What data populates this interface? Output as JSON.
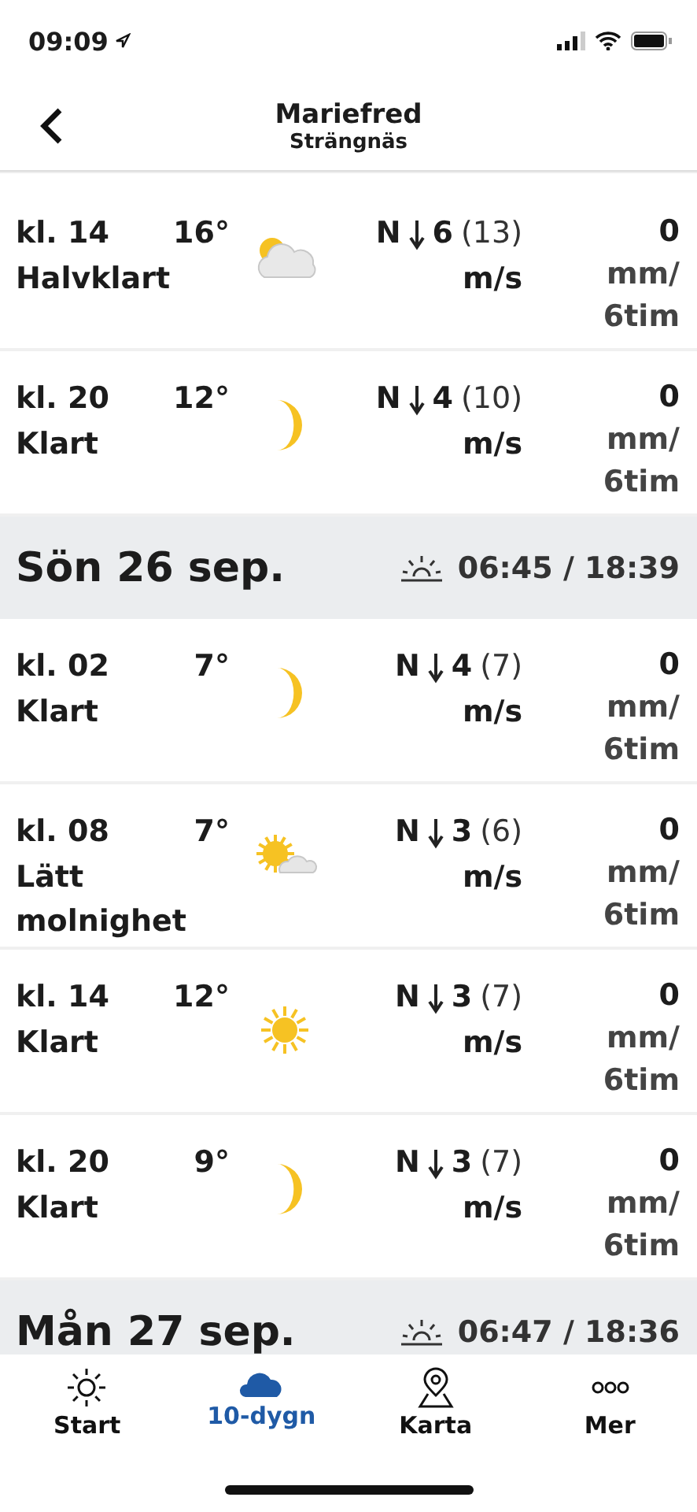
{
  "status_bar": {
    "time": "09:09"
  },
  "header": {
    "title": "Mariefred",
    "subtitle": "Strängnäs"
  },
  "sections": [
    {
      "rows": [
        {
          "time": "kl. 14",
          "temp": "16°",
          "desc": "Halvklart",
          "kind": "partly_cloudy",
          "wind_dir": "N",
          "wind": "6",
          "gust": "(13)",
          "wind_unit": "m/s",
          "precip": "0",
          "precip_unit": [
            "mm/",
            "6tim"
          ]
        },
        {
          "time": "kl. 20",
          "temp": "12°",
          "desc": "Klart",
          "kind": "moon",
          "wind_dir": "N",
          "wind": "4",
          "gust": "(10)",
          "wind_unit": "m/s",
          "precip": "0",
          "precip_unit": [
            "mm/",
            "6tim"
          ]
        }
      ]
    },
    {
      "day": "Sön 26 sep.",
      "sun": "06:45 / 18:39",
      "rows": [
        {
          "time": "kl. 02",
          "temp": "7°",
          "desc": "Klart",
          "kind": "moon",
          "wind_dir": "N",
          "wind": "4",
          "gust": "(7)",
          "wind_unit": "m/s",
          "precip": "0",
          "precip_unit": [
            "mm/",
            "6tim"
          ]
        },
        {
          "time": "kl. 08",
          "temp": "7°",
          "desc": "Lätt molnighet",
          "kind": "sun_cloud",
          "wind_dir": "N",
          "wind": "3",
          "gust": "(6)",
          "wind_unit": "m/s",
          "precip": "0",
          "precip_unit": [
            "mm/",
            "6tim"
          ]
        },
        {
          "time": "kl. 14",
          "temp": "12°",
          "desc": "Klart",
          "kind": "sun",
          "wind_dir": "N",
          "wind": "3",
          "gust": "(7)",
          "wind_unit": "m/s",
          "precip": "0",
          "precip_unit": [
            "mm/",
            "6tim"
          ]
        },
        {
          "time": "kl. 20",
          "temp": "9°",
          "desc": "Klart",
          "kind": "moon",
          "wind_dir": "N",
          "wind": "3",
          "gust": "(7)",
          "wind_unit": "m/s",
          "precip": "0",
          "precip_unit": [
            "mm/",
            "6tim"
          ]
        }
      ]
    },
    {
      "day": "Mån 27 sep.",
      "sun": "06:47 / 18:36"
    }
  ],
  "tabs": [
    {
      "label": "Start",
      "kind": "sun",
      "selected": false
    },
    {
      "label": "10-dygn",
      "kind": "cloud",
      "selected": true
    },
    {
      "label": "Karta",
      "kind": "pin",
      "selected": false
    },
    {
      "label": "Mer",
      "kind": "dots",
      "selected": false
    }
  ]
}
